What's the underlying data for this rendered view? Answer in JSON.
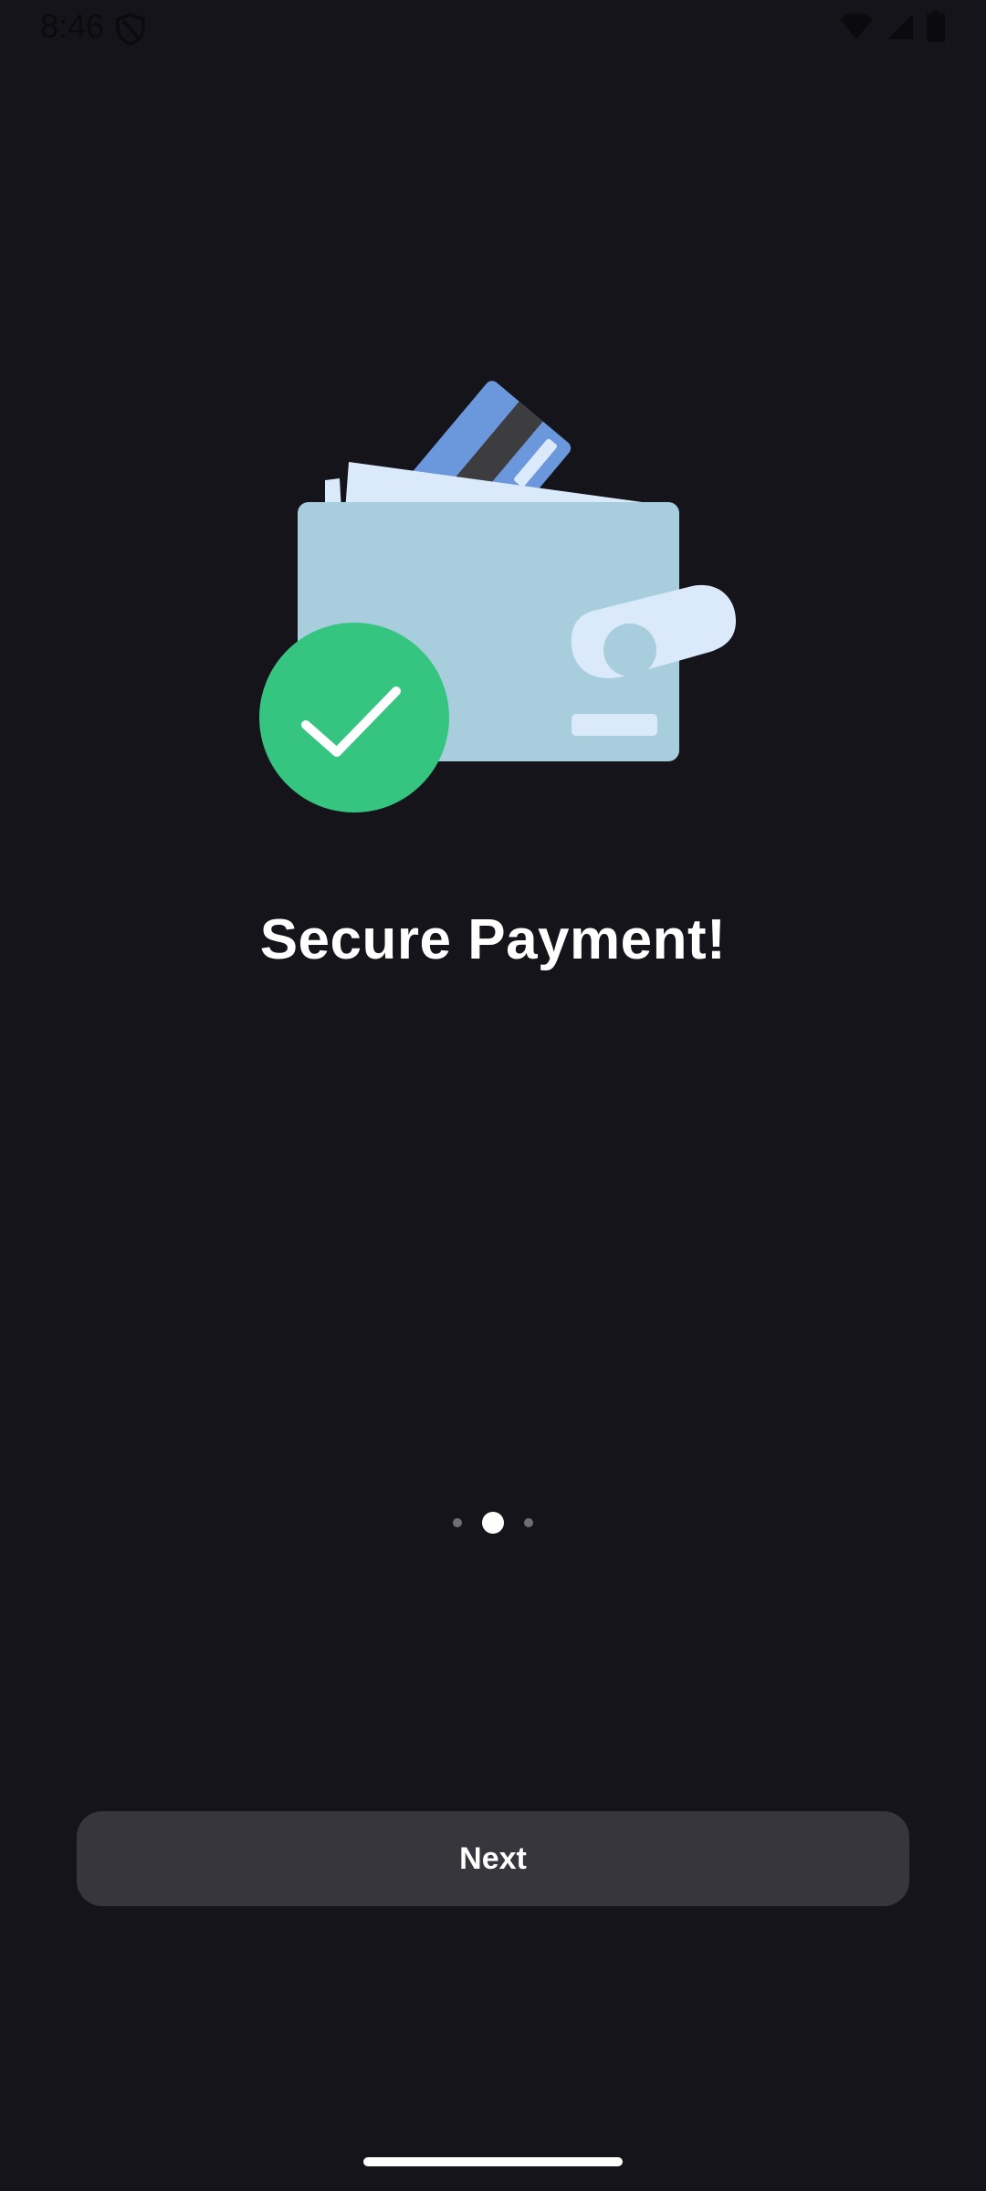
{
  "status_bar": {
    "time": "8:46",
    "icons": [
      "shield-icon",
      "wifi-icon",
      "cellular-signal-icon",
      "battery-icon"
    ]
  },
  "onboarding": {
    "illustration": "wallet-with-card-and-checkmark",
    "title": "Secure Payment!",
    "pager": {
      "total_pages": 3,
      "current_page": 2
    },
    "next_label": "Next"
  },
  "colors": {
    "background": "#14141a",
    "button": "#36363c",
    "check_green": "#36c580",
    "wallet": "#a8cddc",
    "card_blue": "#6b97dd"
  }
}
